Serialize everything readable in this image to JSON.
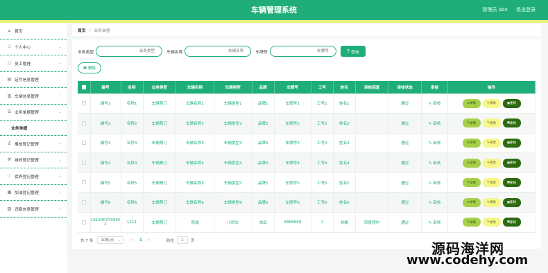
{
  "header": {
    "title": "车辆管理系统",
    "user": "管理员 abo",
    "logout": "退出登录"
  },
  "sidebar": {
    "items": [
      {
        "label": "首页",
        "icon": "home-icon",
        "glyph": "⌂"
      },
      {
        "label": "个人中心",
        "icon": "user-icon",
        "glyph": "⚇"
      },
      {
        "label": "员工管理",
        "icon": "staff-icon",
        "glyph": "☖"
      },
      {
        "label": "证件信息管理",
        "icon": "card-icon",
        "glyph": "▤"
      },
      {
        "label": "车辆信息管理",
        "icon": "car-icon",
        "glyph": "▥"
      },
      {
        "label": "业务单据管理",
        "icon": "doc-icon",
        "glyph": "☰"
      },
      {
        "label": "业务单据",
        "sub": true
      },
      {
        "label": "事故登记管理",
        "icon": "alert-icon",
        "glyph": "♁"
      },
      {
        "label": "维修登记管理",
        "icon": "repair-icon",
        "glyph": "⚒"
      },
      {
        "label": "保养登记管理",
        "icon": "service-icon",
        "glyph": "♡"
      },
      {
        "label": "加油登记管理",
        "icon": "fuel-icon",
        "glyph": "▦"
      },
      {
        "label": "违章信息管理",
        "icon": "ticket-icon",
        "glyph": "▧"
      }
    ]
  },
  "breadcrumb": {
    "home": "首页",
    "separator": "/",
    "current": "业务单据"
  },
  "search": {
    "fields": [
      {
        "label": "业务类型",
        "placeholder": "业务类型"
      },
      {
        "label": "车辆名称",
        "placeholder": "车辆名称"
      },
      {
        "label": "车牌号",
        "placeholder": "车牌号"
      }
    ],
    "query_label": "查询",
    "delete_label": "删除"
  },
  "table": {
    "columns": [
      "编号",
      "名称",
      "业务类型",
      "车辆名称",
      "车辆类型",
      "品牌",
      "车牌号",
      "工号",
      "姓名",
      "审核回复",
      "审核状态",
      "审核",
      "操作"
    ],
    "rows": [
      [
        "编号1",
        "名称1",
        "车辆预订",
        "车辆名称1",
        "车辆类型1",
        "品牌1",
        "车牌号1",
        "工号1",
        "姓名1",
        "",
        "通过"
      ],
      [
        "编号2",
        "名称2",
        "车辆预订",
        "车辆名称2",
        "车辆类型2",
        "品牌2",
        "车牌号2",
        "工号2",
        "姓名2",
        "",
        "通过"
      ],
      [
        "编号3",
        "名称3",
        "车辆预订",
        "车辆名称3",
        "车辆类型3",
        "品牌3",
        "车牌号3",
        "工号3",
        "姓名3",
        "",
        "通过"
      ],
      [
        "编号4",
        "名称4",
        "车辆预订",
        "车辆名称4",
        "车辆类型4",
        "品牌4",
        "车牌号4",
        "工号4",
        "姓名4",
        "",
        "通过"
      ],
      [
        "编号5",
        "名称5",
        "车辆预订",
        "车辆名称5",
        "车辆类型5",
        "品牌5",
        "车牌号5",
        "工号5",
        "姓名5",
        "",
        "通过"
      ],
      [
        "编号6",
        "名称6",
        "车辆预订",
        "车辆名称6",
        "车辆类型6",
        "品牌6",
        "车牌号6",
        "工号6",
        "姓名6",
        "",
        "通过"
      ],
      [
        "1619403799952",
        "1111",
        "车辆预订",
        "思域",
        "小轿车",
        "本田",
        "A888888",
        "1",
        "刘曦",
        "同意预约",
        "通过"
      ]
    ],
    "audit_label": "审核",
    "detail_label": "详情",
    "edit_label": "修改",
    "delete_label": "删除"
  },
  "pager": {
    "total": "共 7 条",
    "page_size": "10条/页",
    "prev": "<",
    "current_page": "1",
    "next": ">",
    "goto_label": "前往",
    "goto_value": "1",
    "page_unit": "页"
  },
  "watermark": {
    "line1": "源码海洋网",
    "line2": "www.codehy.com"
  },
  "colors": {
    "primary": "#1fae7a",
    "accent": "#e7f27a",
    "detail": "#a7cf4a",
    "edit": "#f6f68a",
    "delete": "#2e6b10"
  }
}
